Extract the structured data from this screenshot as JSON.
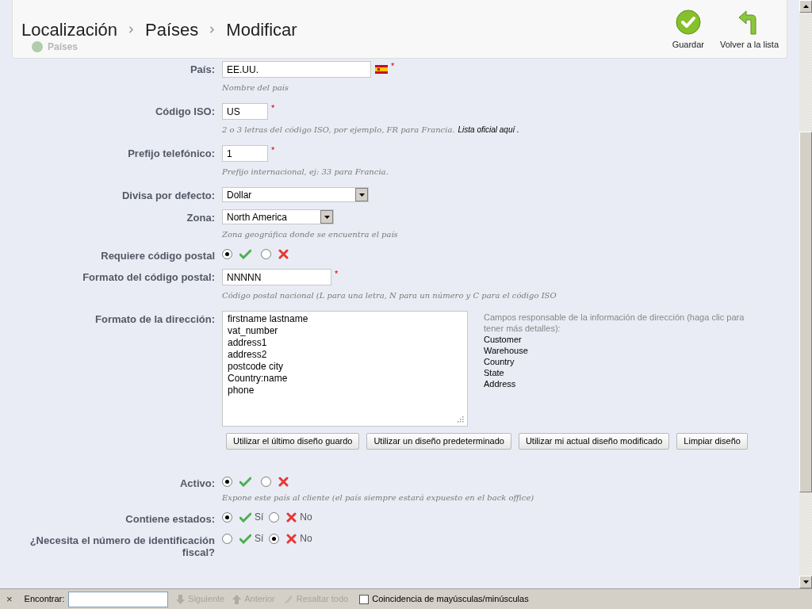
{
  "header": {
    "breadcrumb": [
      "Localización",
      "Países",
      "Modificar"
    ],
    "behind_title": "Países",
    "actions": [
      {
        "kind": "save",
        "label": "Guardar"
      },
      {
        "kind": "back",
        "label": "Volver a la lista"
      }
    ]
  },
  "fields": [
    {
      "kind": "text",
      "label": "País:",
      "value": "EE.UU.",
      "flag": true,
      "required_mark": "*",
      "hint": "Nombre del país"
    },
    {
      "kind": "text",
      "label": "Código ISO:",
      "value": "US",
      "required_mark": "*",
      "hint": "2 o 3 letras del código ISO, por ejemplo, FR para Francia.",
      "hint_link": "Lista oficial aquí ."
    },
    {
      "kind": "text",
      "label": "Prefijo telefónico:",
      "value": "1",
      "required_mark": "*",
      "hint": "Prefijo internacional, ej: 33 para Francia."
    },
    {
      "kind": "select",
      "label": "Divisa por defecto:",
      "value": "Dollar"
    },
    {
      "kind": "select",
      "label": "Zona:",
      "value": "North America",
      "hint": "Zona geográfica donde se encuentra el país"
    },
    {
      "kind": "radio",
      "label": "Requiere código postal",
      "options": [
        {
          "kind": "yes",
          "selected": true
        },
        {
          "kind": "no",
          "selected": false
        }
      ]
    },
    {
      "kind": "text",
      "label": "Formato del código postal:",
      "value": "NNNNN",
      "required_mark": "*",
      "hint": "Código postal nacional (L para una letra, N para un número y C para el código ISO"
    },
    {
      "kind": "textarea",
      "label": "Formato de la dirección:",
      "value": "firstname lastname\nvat_number\naddress1\naddress2\npostcode city\nCountry:name\nphone",
      "help": "Campos responsable de la información de dirección (haga clic para tener más detalles):",
      "links": [
        "Customer",
        "Warehouse",
        "Country",
        "State",
        "Address"
      ],
      "buttons": [
        "Utilizar el último diseño guardo",
        "Utilizar un diseño predeterminado",
        "Utilizar mi actual diseño modificado",
        "Limpiar diseño"
      ]
    },
    {
      "kind": "radio",
      "label": "Activo:",
      "options": [
        {
          "kind": "yes",
          "selected": true
        },
        {
          "kind": "no",
          "selected": false
        }
      ],
      "hint": "Expone este país al cliente (el país siempre estará expuesto en el back office)"
    },
    {
      "kind": "radio",
      "label": "Contiene estados:",
      "options": [
        {
          "kind": "yes",
          "label": "Sí",
          "selected": true
        },
        {
          "kind": "no",
          "label": "No",
          "selected": false
        }
      ]
    },
    {
      "kind": "radio",
      "label": "¿Necesita el número de identificación fiscal?",
      "options": [
        {
          "kind": "yes",
          "label": "Sí",
          "selected": false
        },
        {
          "kind": "no",
          "label": "No",
          "selected": true
        }
      ]
    }
  ],
  "find_bar": {
    "close": "×",
    "label": "Encontrar:",
    "buttons": [
      {
        "kind": "down",
        "label": "Siguiente"
      },
      {
        "kind": "up",
        "label": "Anterior"
      },
      {
        "kind": "highlight",
        "label": "Resaltar todo"
      }
    ],
    "match_case": {
      "label": "Coincidencia de mayúsculas/minúsculas",
      "checked": false
    }
  }
}
